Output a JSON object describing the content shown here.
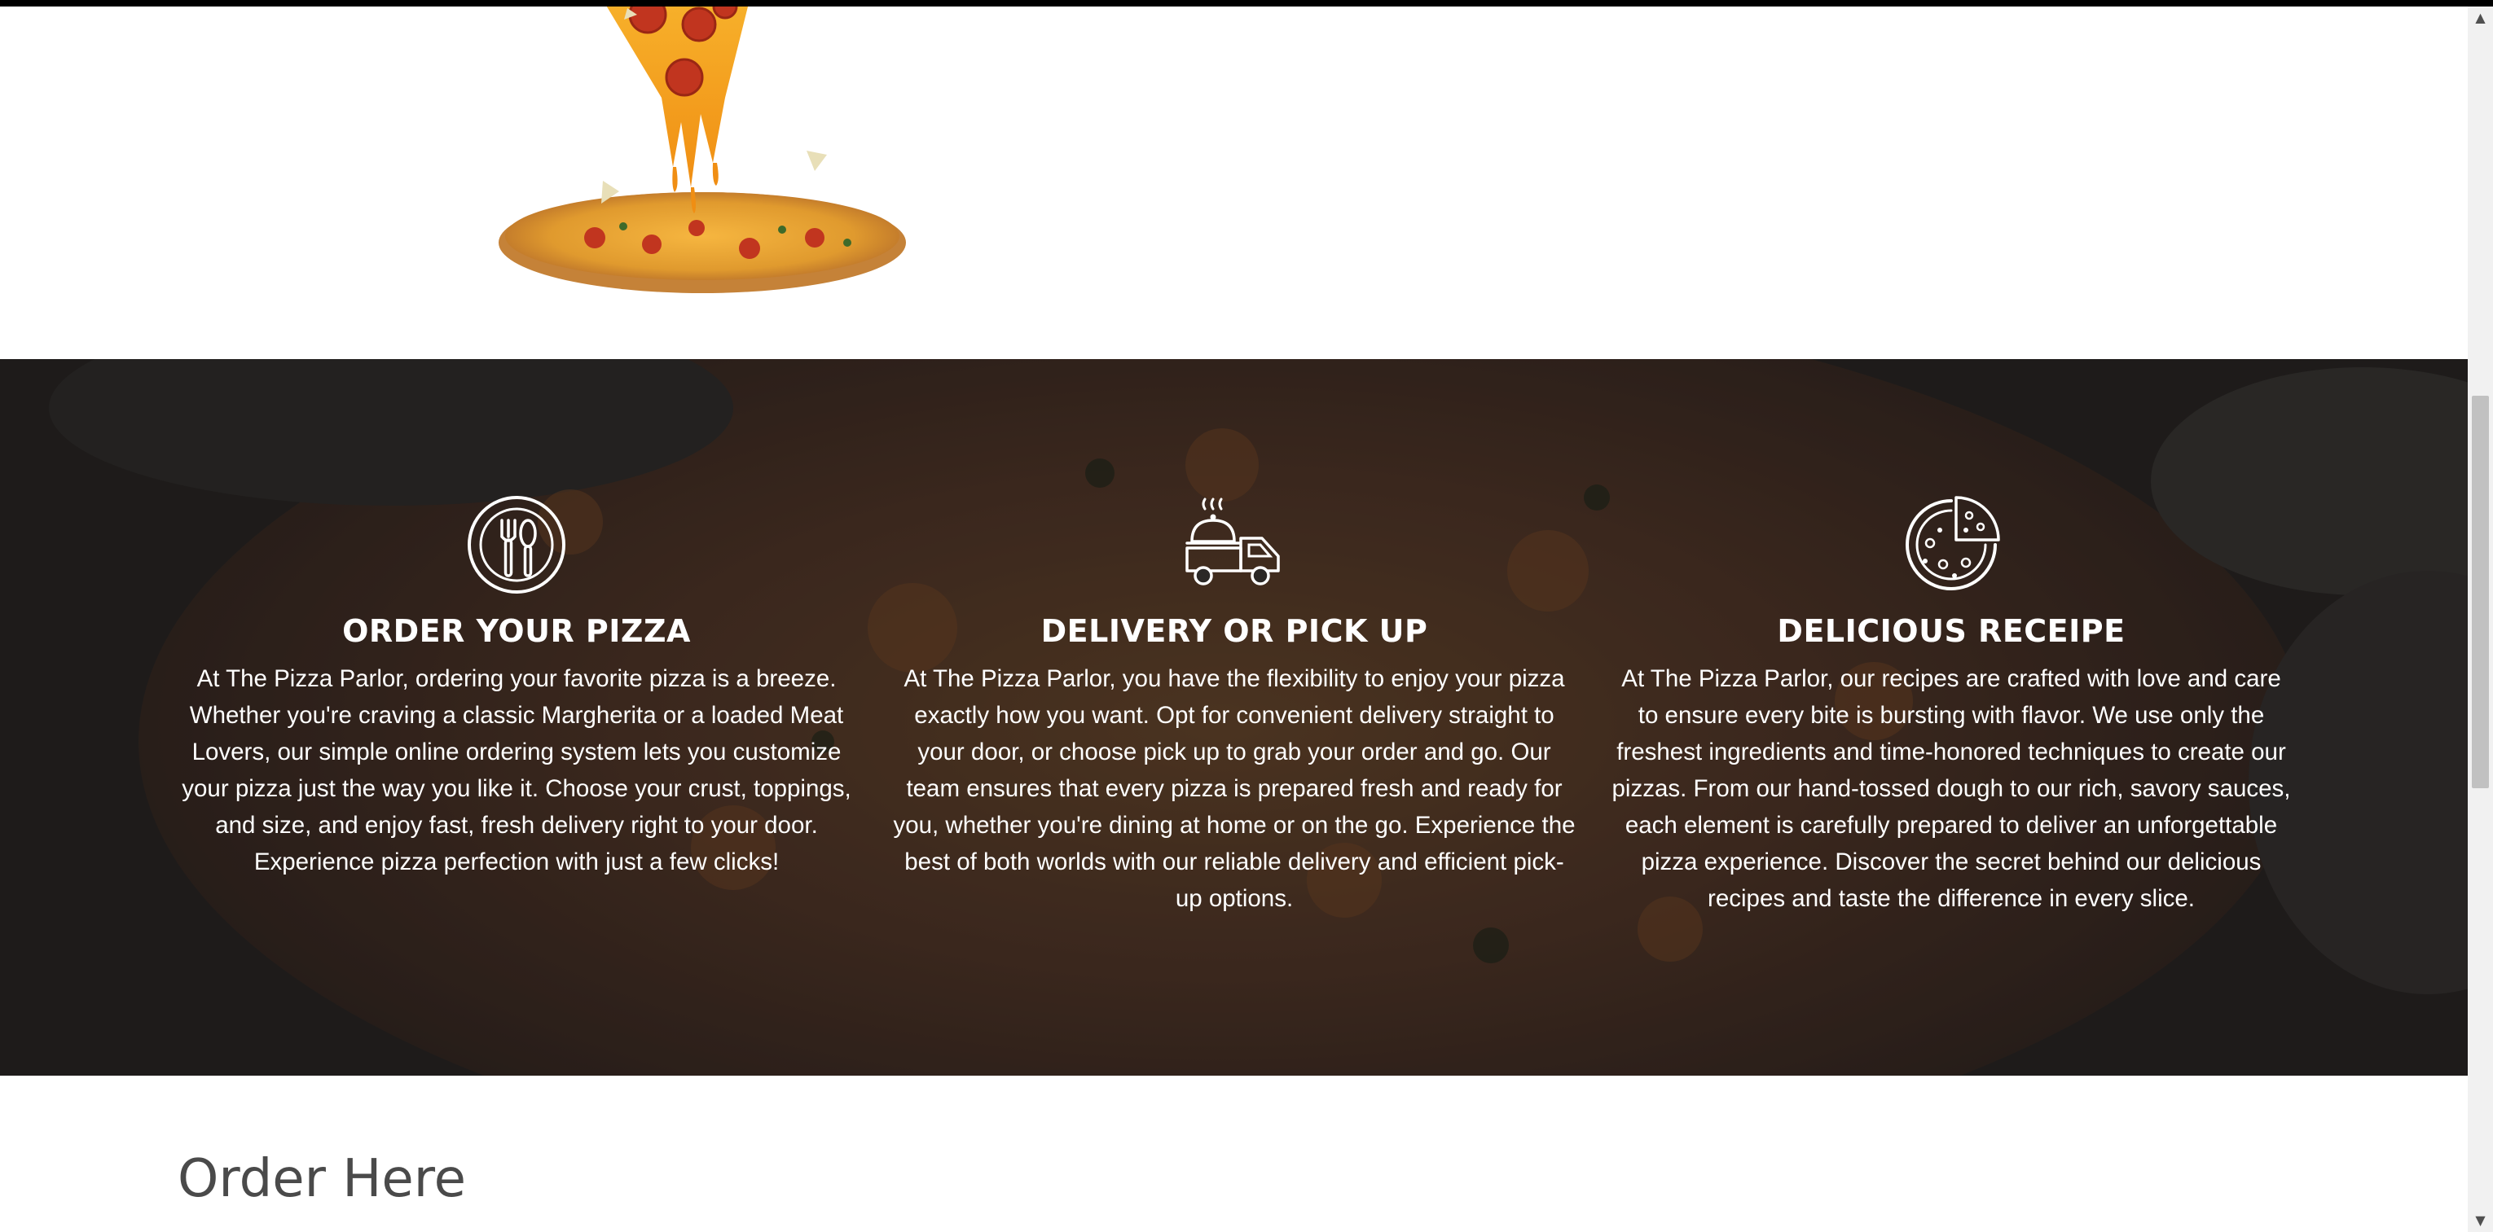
{
  "features": [
    {
      "icon": "utensils-plate-icon",
      "title": "ORDER YOUR PIZZA",
      "text": "At The Pizza Parlor, ordering your favorite pizza is a breeze. Whether you're craving a classic Margherita or a loaded Meat Lovers, our simple online ordering system lets you customize your pizza just the way you like it. Choose your crust, toppings, and size, and enjoy fast, fresh delivery right to your door. Experience pizza perfection with just a few clicks!"
    },
    {
      "icon": "delivery-truck-icon",
      "title": "DELIVERY OR PICK UP",
      "text": "At The Pizza Parlor, you have the flexibility to enjoy your pizza exactly how you want. Opt for convenient delivery straight to your door, or choose pick up to grab your order and go. Our team ensures that every pizza is prepared fresh and ready for you, whether you're dining at home or on the go. Experience the best of both worlds with our reliable delivery and efficient pick-up options."
    },
    {
      "icon": "pizza-slice-icon",
      "title": "DELICIOUS RECEIPE",
      "text": "At The Pizza Parlor, our recipes are crafted with love and care to ensure every bite is bursting with flavor. We use only the freshest ingredients and time-honored techniques to create our pizzas. From our hand-tossed dough to our rich, savory sauces, each element is carefully prepared to deliver an unforgettable pizza experience. Discover the secret behind our delicious recipes and taste the difference in every slice."
    }
  ],
  "order": {
    "title": "Order Here"
  },
  "colors": {
    "section_dark": "#2a2624",
    "text_light": "#ffffff",
    "heading_dark": "#4a4a4a",
    "cheese": "#f2a51f",
    "pepperoni": "#c1351f"
  }
}
